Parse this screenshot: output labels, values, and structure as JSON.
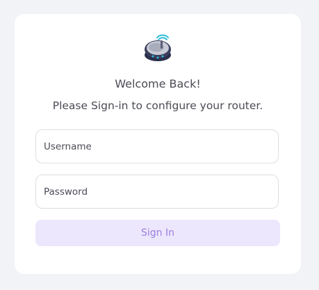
{
  "logo": {
    "icon": "router-icon",
    "accent": "#2bbcd8"
  },
  "login": {
    "welcome": "Welcome Back!",
    "subtitle": "Please Sign-in to configure your router.",
    "username_placeholder": "Username",
    "password_placeholder": "Password",
    "signin_label": "Sign In"
  },
  "colors": {
    "page_background": "#f2f3f7",
    "card_background": "#ffffff",
    "button_background": "#ede7fd",
    "button_text": "#9b7fe0"
  }
}
